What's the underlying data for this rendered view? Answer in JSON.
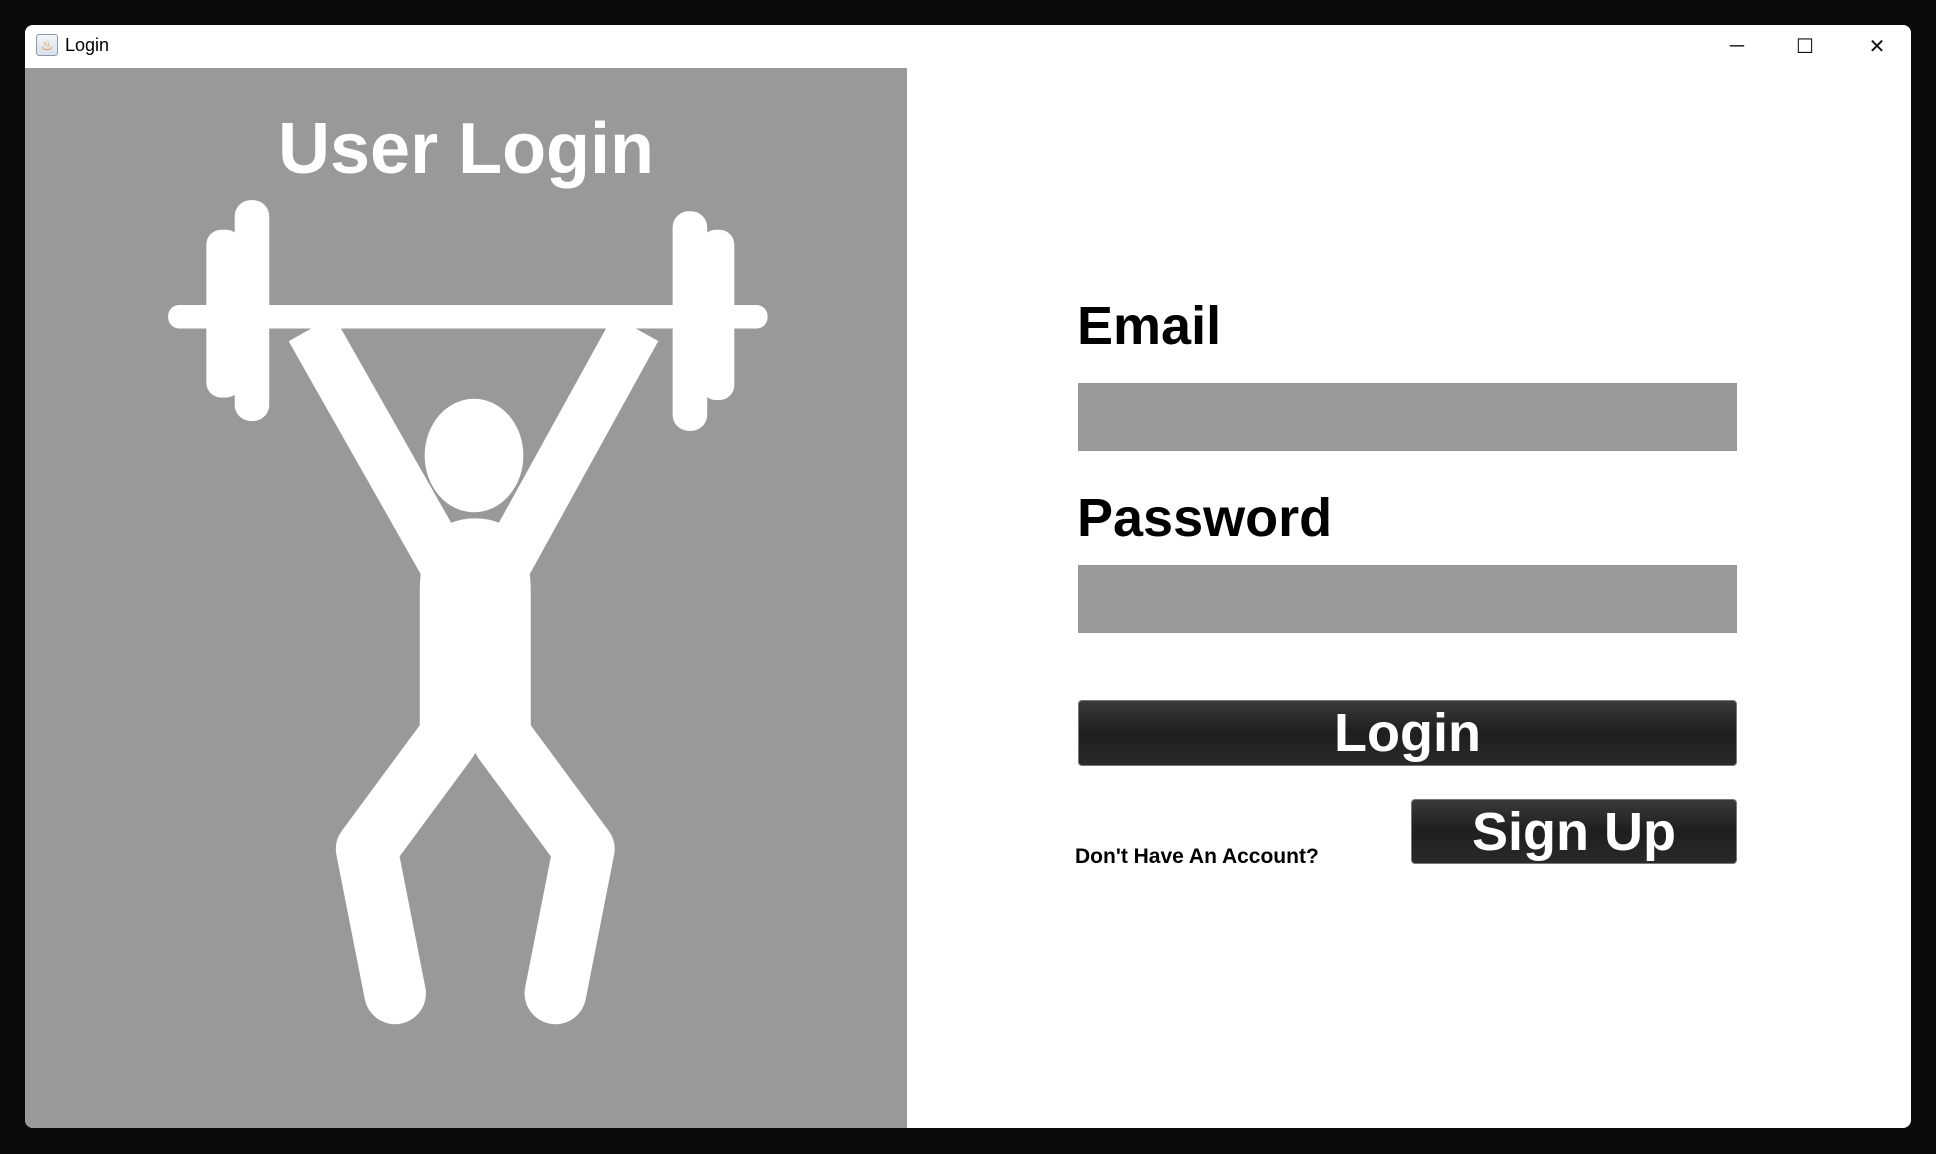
{
  "window": {
    "title": "Login",
    "app_icon": "java-icon",
    "controls": {
      "minimize": "─",
      "maximize": "☐",
      "close": "✕"
    }
  },
  "left_panel": {
    "heading": "User Login",
    "illustration": "weightlifter-icon",
    "background": "#999999"
  },
  "form": {
    "email_label": "Email",
    "email_value": "",
    "password_label": "Password",
    "password_value": "",
    "login_button": "Login",
    "signup_prompt": "Don't Have An Account?",
    "signup_button": "Sign Up"
  },
  "colors": {
    "field": "#999999",
    "button": "#262626",
    "button_text": "#ffffff"
  }
}
